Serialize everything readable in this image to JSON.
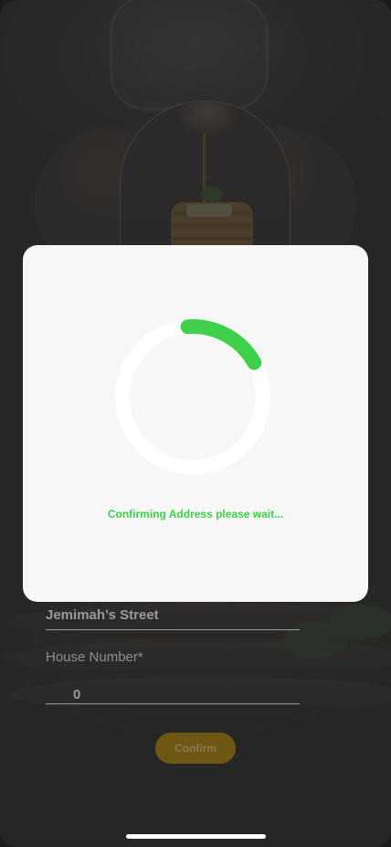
{
  "form": {
    "street_value": "Jemimah’s Street",
    "house_number_label": "House Number*",
    "house_number_value": "0",
    "confirm_label": "Confirm"
  },
  "loading": {
    "message": "Confirming Address please wait...",
    "progress_fraction": 0.18
  },
  "colors": {
    "accent_green": "#3fd14b",
    "confirm_button": "#6e5613",
    "modal_background": "#f7f7f7"
  },
  "icons": {
    "spinner": "loading-spinner-icon"
  }
}
